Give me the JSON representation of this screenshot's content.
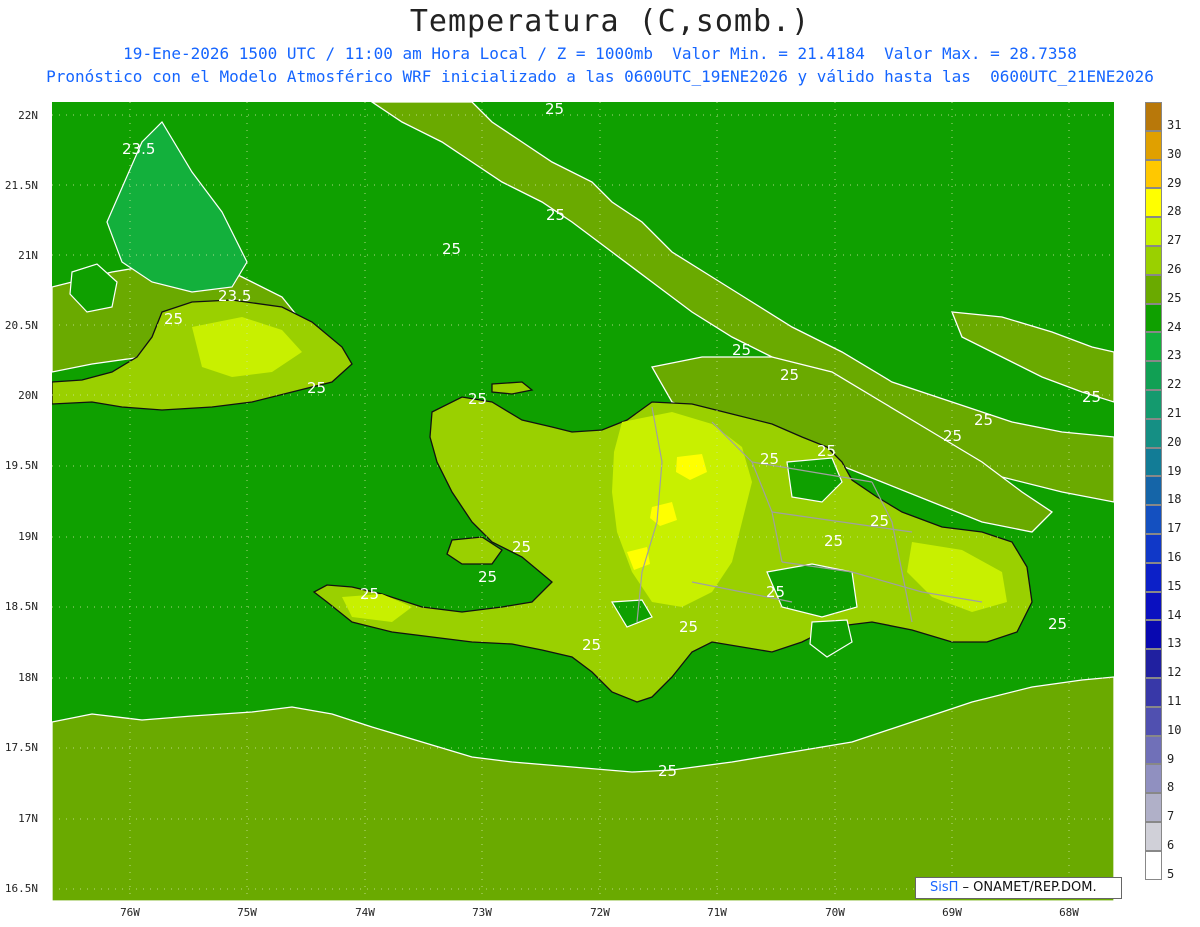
{
  "header": {
    "title": "Temperatura (C,somb.)",
    "line1": "19-Ene-2026 1500 UTC / 11:00 am Hora Local / Z = 1000mb  Valor Min. = 21.4184  Valor Max. = 28.7358",
    "line2": "Pronóstico con el Modelo Atmosférico WRF inicializado a las 0600UTC_19ENE2026 y válido hasta las  0600UTC_21ENE2026"
  },
  "axes": {
    "lat_labels": [
      "22N",
      "21.5N",
      "21N",
      "20.5N",
      "20N",
      "19.5N",
      "19N",
      "18.5N",
      "18N",
      "17.5N",
      "17N",
      "16.5N"
    ],
    "lon_labels": [
      "76W",
      "75W",
      "74W",
      "73W",
      "72W",
      "71W",
      "70W",
      "69W",
      "68W"
    ]
  },
  "colorbar": {
    "labels": [
      "31",
      "30",
      "29",
      "28",
      "27",
      "26",
      "25",
      "24",
      "23",
      "22",
      "21",
      "20",
      "19",
      "18",
      "17",
      "16",
      "15",
      "14",
      "13",
      "12",
      "11",
      "10",
      "9",
      "8",
      "7",
      "6",
      "5"
    ],
    "colors": [
      "#b8780a",
      "#e0a000",
      "#ffc800",
      "#ffff00",
      "#c8f000",
      "#9ad000",
      "#6aaa00",
      "#0fa000",
      "#13b03c",
      "#11a054",
      "#149a6e",
      "#158f84",
      "#127c96",
      "#1565a8",
      "#1450c0",
      "#1038c8",
      "#0c20c8",
      "#0a10c0",
      "#0808b0",
      "#2020a0",
      "#3838a8",
      "#5050b0",
      "#7070b8",
      "#9090c0",
      "#b0b0c8",
      "#d0d0d8",
      "#ffffff"
    ]
  },
  "map": {
    "contour_labels": [
      "25",
      "25",
      "25",
      "25",
      "25",
      "25",
      "25",
      "25",
      "25",
      "25",
      "25",
      "25",
      "25",
      "25",
      "25",
      "25",
      "25",
      "25",
      "25",
      "25",
      "25",
      "25",
      "25",
      "23.5",
      "23.5"
    ],
    "ocean_color": "#0fa000",
    "warm_band_color": "#6aaa00",
    "land_color": "#9ad000",
    "hot_color": "#c8f000",
    "hottest_color": "#ffff00"
  },
  "credit": {
    "brand": "SisΠ",
    "text": " – ONAMET/REP.DOM."
  }
}
